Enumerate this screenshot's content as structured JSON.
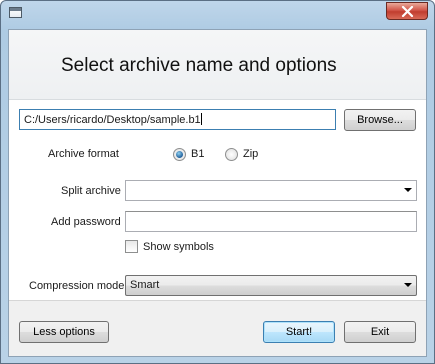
{
  "window": {
    "close_icon": "close-icon",
    "app_icon": "window-icon"
  },
  "header": {
    "title": "Select archive name and options"
  },
  "archive_path": {
    "value": "C:/Users/ricardo/Desktop/sample.b1",
    "browse_label": "Browse..."
  },
  "archive_format": {
    "label": "Archive format",
    "options": [
      {
        "label": "B1",
        "checked": true
      },
      {
        "label": "Zip",
        "checked": false
      }
    ]
  },
  "split_archive": {
    "label": "Split archive",
    "value": ""
  },
  "password": {
    "label": "Add password",
    "value": "",
    "show_symbols_label": "Show symbols",
    "show_symbols_checked": false
  },
  "compression": {
    "label": "Compression mode",
    "value": "Smart"
  },
  "footer": {
    "less_options_label": "Less options",
    "start_label": "Start!",
    "exit_label": "Exit"
  }
}
